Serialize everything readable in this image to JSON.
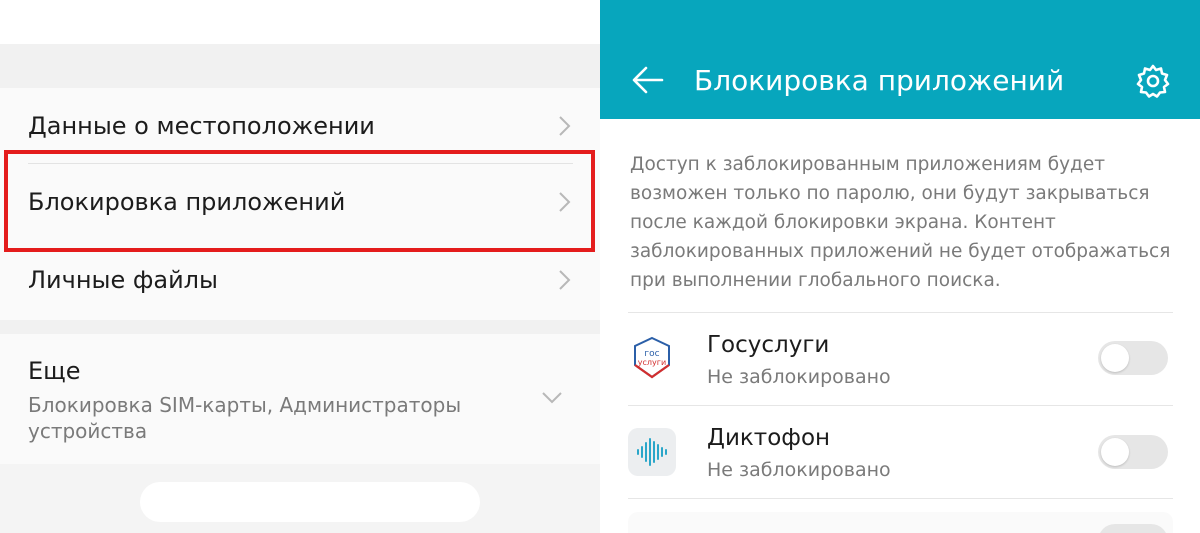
{
  "left": {
    "items": [
      {
        "label": "Данные о местоположении"
      },
      {
        "label": "Блокировка приложений"
      },
      {
        "label": "Личные файлы"
      }
    ],
    "more": {
      "title": "Еще",
      "subtitle": "Блокировка SIM-карты, Администраторы устройства"
    },
    "highlight_color": "#e41c1c"
  },
  "right": {
    "appbar": {
      "title": "Блокировка приложений",
      "color": "#07a6bd",
      "back_icon": "arrow-back-icon",
      "settings_icon": "gear-icon"
    },
    "description": "Доступ к заблокированным приложениям будет возможен только по паролю, они будут закрываться после каждой блокировки экрана. Контент заблокированных приложений не будет отображаться при выполнении глобального поиска.",
    "apps": [
      {
        "name": "Госуслуги",
        "status": "Не заблокировано",
        "icon_text": "гос услуги",
        "locked": false
      },
      {
        "name": "Диктофон",
        "status": "Не заблокировано",
        "locked": false
      }
    ]
  }
}
